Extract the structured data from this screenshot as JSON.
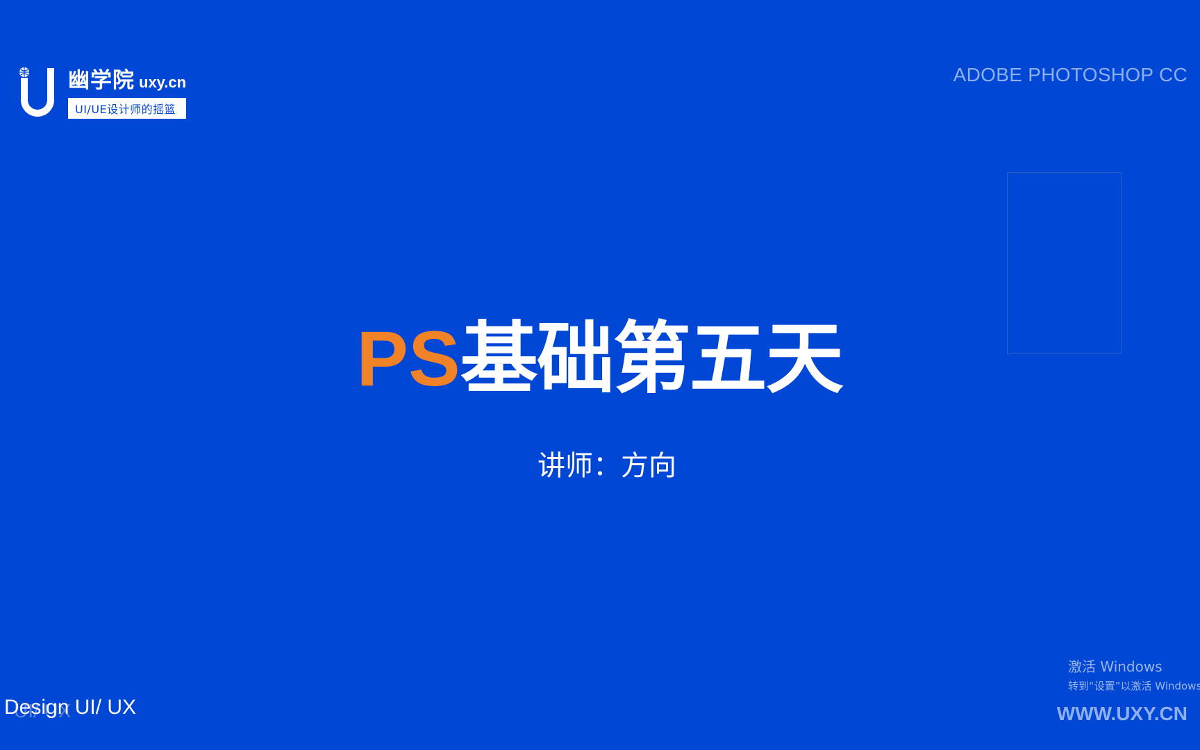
{
  "logo": {
    "icon": "uxy-u-logo-icon",
    "name_cn": "幽学院",
    "domain": "uxy.cn",
    "tagline": "UI/UE设计师的摇篮"
  },
  "header": {
    "right_label": "ADOBE PHOTOSHOP CC"
  },
  "title": {
    "prefix": "PS",
    "main": "基础第五天"
  },
  "instructor": {
    "label": "讲师：",
    "name": "方向"
  },
  "activation": {
    "title": "激活 Windows",
    "subtitle": "转到“设置”以激活 Windows。"
  },
  "footer": {
    "ghost_text": "UI/ UX",
    "left_text": "Design UI/ UX",
    "right_text": "WWW.UXY.CN"
  },
  "colors": {
    "background": "#0047D6",
    "accent_orange": "#F28228",
    "text_white": "#FFFFFF",
    "muted_blue": "#8FB0F0"
  }
}
